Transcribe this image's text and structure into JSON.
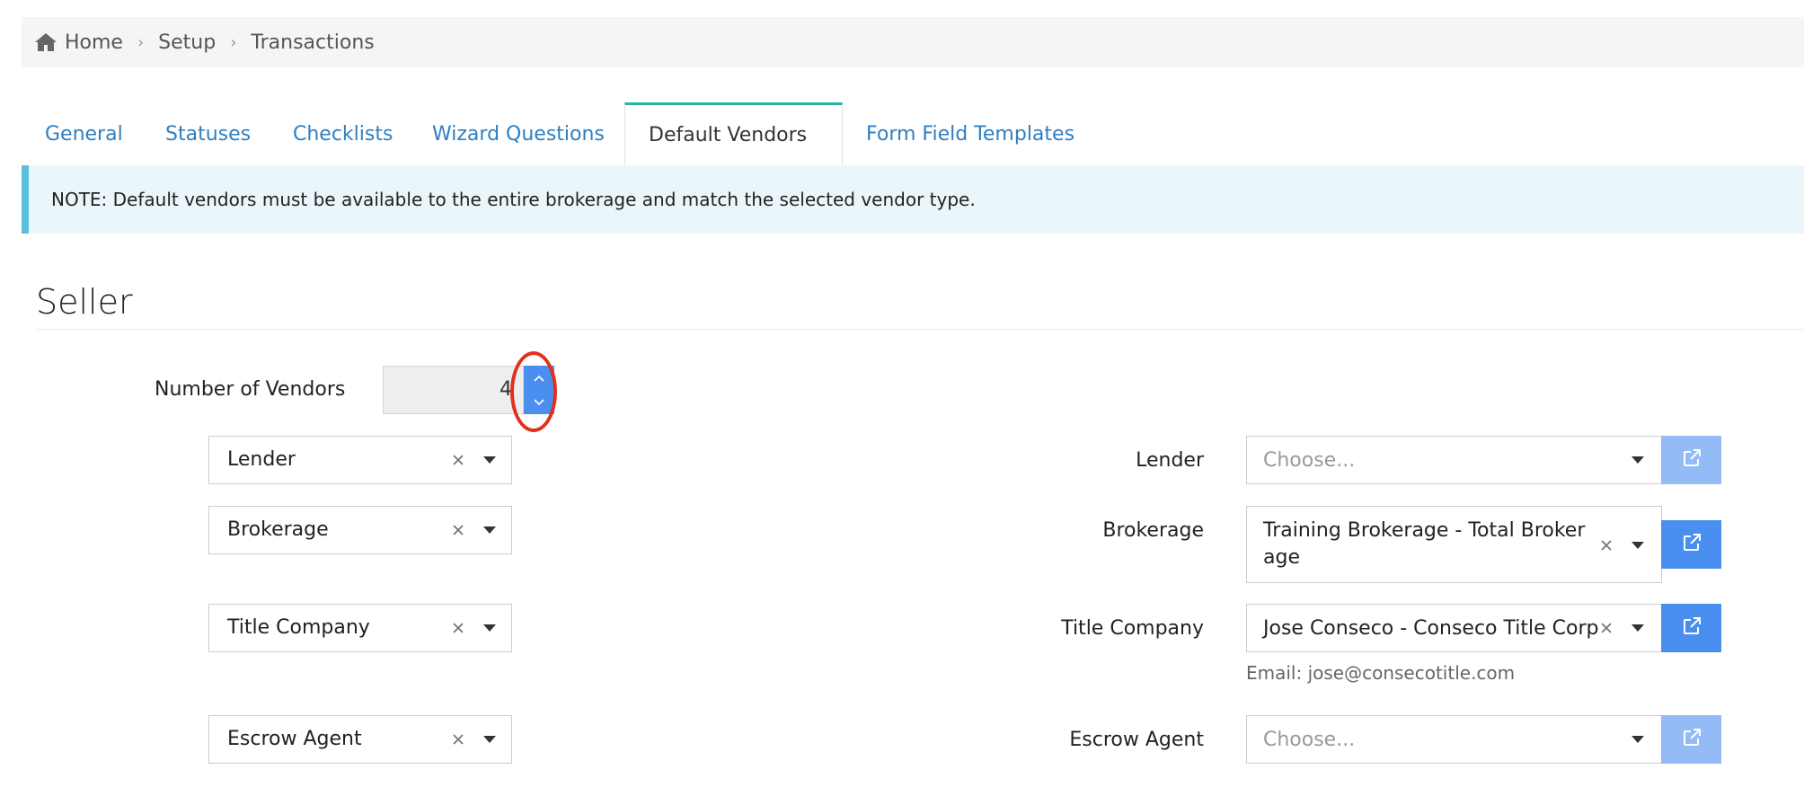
{
  "breadcrumb": {
    "items": [
      "Home",
      "Setup",
      "Transactions"
    ]
  },
  "tabs": [
    "General",
    "Statuses",
    "Checklists",
    "Wizard Questions",
    "Default Vendors",
    "Form Field Templates"
  ],
  "active_tab": "Default Vendors",
  "note": "NOTE: Default vendors must be available to the entire brokerage and match the selected vendor type.",
  "section_title": "Seller",
  "number_of_vendors": {
    "label": "Number of Vendors",
    "value": "4"
  },
  "vendor_types": [
    "Lender",
    "Brokerage",
    "Title Company",
    "Escrow Agent"
  ],
  "vendors": [
    {
      "label": "Lender",
      "value": "Choose...",
      "placeholder": true
    },
    {
      "label": "Brokerage",
      "value": "Training Brokerage - Total Brokerage",
      "placeholder": false
    },
    {
      "label": "Title Company",
      "value": "Jose Conseco - Conseco Title Corp",
      "placeholder": false,
      "note": "Email: jose@consecotitle.com"
    },
    {
      "label": "Escrow Agent",
      "value": "Choose...",
      "placeholder": true
    }
  ],
  "colors": {
    "accent": "#4a8ff0",
    "link": "#2f7fc1",
    "tab_border": "#26b5a4",
    "highlight": "#e0301e"
  },
  "icons": [
    "home-icon",
    "chevron-right-icon",
    "chevron-up-icon",
    "chevron-down-icon",
    "clear-icon",
    "caret-down-icon",
    "external-link-icon"
  ]
}
